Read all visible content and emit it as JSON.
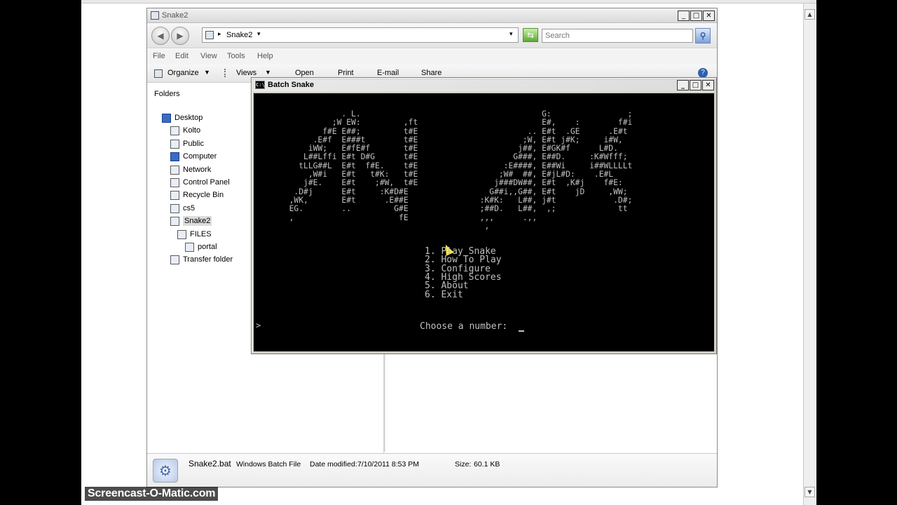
{
  "explorer": {
    "title": "Snake2",
    "address": "Snake2",
    "search_placeholder": "Search",
    "menu": [
      "File",
      "Edit",
      "View",
      "Tools",
      "Help"
    ],
    "toolbar": [
      "Organize",
      "Views",
      "Open",
      "Print",
      "E-mail",
      "Share"
    ],
    "folders_header": "Folders",
    "tree": [
      "Desktop",
      "Kolto",
      "Public",
      "Computer",
      "Network",
      "Control Panel",
      "Recycle Bin",
      "cs5",
      "Snake2",
      "FILES",
      "portal",
      "Transfer folder"
    ],
    "details": {
      "filename": "Snake2.bat",
      "type": "Windows Batch File",
      "date_label": "Date modified:",
      "date": "7/10/2011 8:53 PM",
      "size_label": "Size:",
      "size": "60.1 KB"
    }
  },
  "console": {
    "title": "Batch Snake",
    "art": "                  . L.                                      G:                ;\n                ;W EW:         ,ft                          E#,    :        f#i\n              f#E E##;         t#E                       .. E#t  .GE      .E#t\n            .E#f  E###t        t#E                      ;W, E#t j#K;     i#W,\n           iWW;   E#fE#f       t#E                     j##, E#GK#f      L#D.\n          L##Lffi E#t D#G      t#E                    G###, E##D.     :K#Wfff;\n         tLLG##L  E#t  f#E.    t#E                  :E####, E##Wi     i##WLLLLt\n           ,W#i   E#t   t#K:   t#E                 ;W#  ##, E#jL#D:    .E#L\n          j#E.    E#t    ;#W,  t#E                j###DW##, E#t  ,K#j    f#E:\n        .D#j      E#t     :K#D#E                 G##i,,G##, E#t    jD     ,WW;\n       ,WK,       E#t      .E##E               :K#K:   L##, j#t            .D#;\n       EG.        ..         G#E               ;##D.   L##,  ,;             tt\n       ,                      fE               ,,,      .,,\n                                                ,",
    "options": [
      "1. Play Snake",
      "2. How To Play",
      "3. Configure",
      "4. High Scores",
      "5. About",
      "6. Exit"
    ],
    "prompt": "Choose a number:",
    "caret": ">"
  },
  "watermark": "Screencast-O-Matic.com"
}
